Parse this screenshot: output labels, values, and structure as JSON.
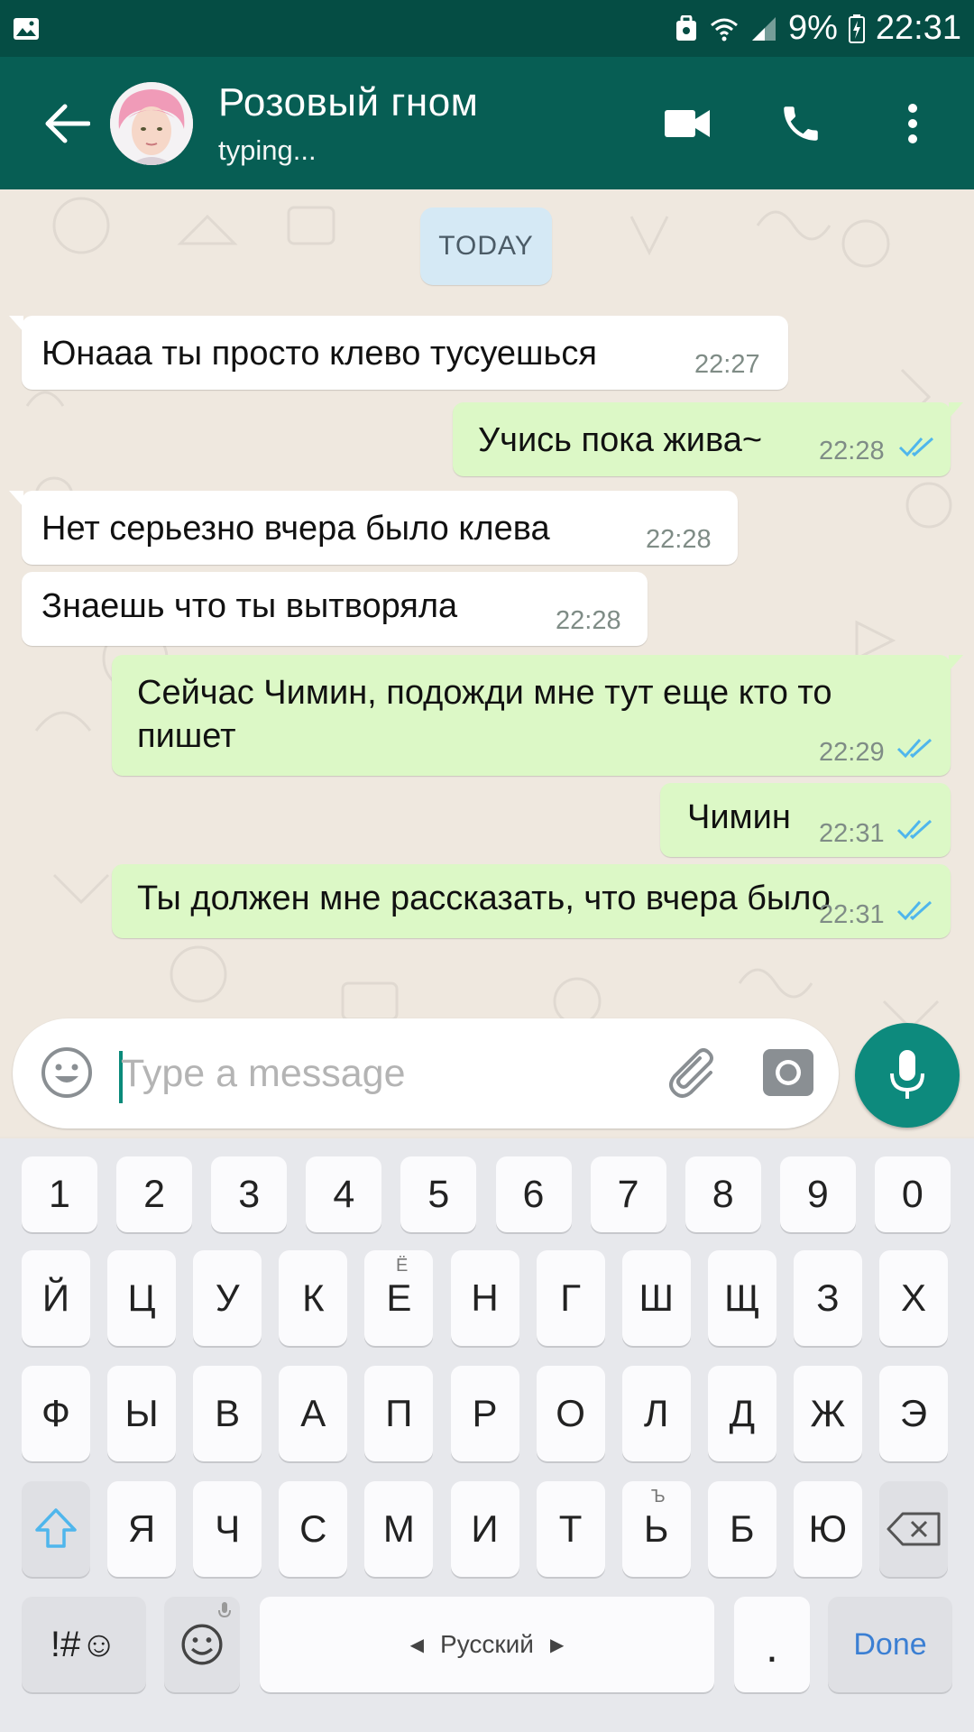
{
  "status_bar": {
    "battery": "9%",
    "time": "22:31",
    "icons": [
      "gallery-icon",
      "shield-icon",
      "wifi-icon",
      "signal-icon",
      "battery-icon"
    ]
  },
  "header": {
    "contact_name": "Розовый гном",
    "contact_status": "typing...",
    "colors": {
      "bar": "#075e54",
      "status": "#054d44"
    }
  },
  "chat": {
    "date_chip": "TODAY",
    "messages": [
      {
        "direction": "in",
        "text": "Юнааа ты просто клево тусуешься",
        "time": "22:27"
      },
      {
        "direction": "out",
        "text": "Учись пока жива~",
        "time": "22:28",
        "ticks": "read"
      },
      {
        "direction": "in",
        "text": "Нет серьезно вчера было клева",
        "time": "22:28"
      },
      {
        "direction": "in",
        "text": "Знаешь что ты вытворяла",
        "time": "22:28"
      },
      {
        "direction": "out",
        "text": "Сейчас Чимин, подожди мне тут еще кто то пишет",
        "time": "22:29",
        "ticks": "read"
      },
      {
        "direction": "out",
        "text": "Чимин",
        "time": "22:31",
        "ticks": "read"
      },
      {
        "direction": "out",
        "text": "Ты должен мне рассказать, что вчера было",
        "time": "22:31",
        "ticks": "read"
      }
    ],
    "colors": {
      "incoming": "#ffffff",
      "outgoing": "#dcf8c6",
      "ticks": "#4fb6ec"
    }
  },
  "composer": {
    "placeholder": "Type a message",
    "value": ""
  },
  "keyboard": {
    "row_numbers": [
      "1",
      "2",
      "3",
      "4",
      "5",
      "6",
      "7",
      "8",
      "9",
      "0"
    ],
    "row1": [
      "Й",
      "Ц",
      "У",
      "К",
      "Е",
      "Н",
      "Г",
      "Ш",
      "Щ",
      "З",
      "Х"
    ],
    "row1_sup": {
      "Е": "Ё"
    },
    "row2": [
      "Ф",
      "Ы",
      "В",
      "А",
      "П",
      "Р",
      "О",
      "Л",
      "Д",
      "Ж",
      "Э"
    ],
    "row3": [
      "Я",
      "Ч",
      "С",
      "М",
      "И",
      "Т",
      "Ь",
      "Б",
      "Ю"
    ],
    "row3_sup": {
      "Ь": "Ъ"
    },
    "symbols_label": "!#☺",
    "space_label": "Русский",
    "period_label": ".",
    "done_label": "Done"
  }
}
